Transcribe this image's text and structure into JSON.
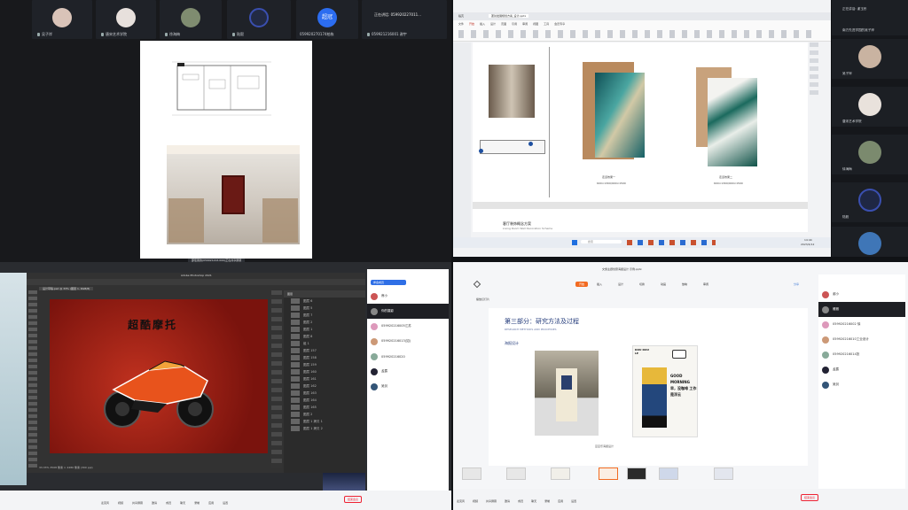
{
  "top_left": {
    "tiles": [
      {
        "name": "吴子岸"
      },
      {
        "name": "唐宋艺术学院"
      },
      {
        "name": "徐海梅"
      },
      {
        "name": "陆毅"
      },
      {
        "name": "059920270174柏栋",
        "initials": "超冠"
      },
      {
        "name": "059921216001 谢宇"
      }
    ],
    "speaking": "正在讲话: 059920227011...",
    "caption": "邵佳豪的(059921216 000)正在共享屏幕"
  },
  "top_right": {
    "window_title": "蓬勃发展规划方案_设计.pptx",
    "tabs": [
      "稻壳",
      "蓬勃发展规划方案_设计.pptx"
    ],
    "menu": [
      "文件",
      "开始",
      "插入",
      "设计",
      "页面",
      "引用",
      "审阅",
      "视图",
      "工具",
      "会员专享"
    ],
    "page_label": "页",
    "slide": {
      "caption1": "走道效果一",
      "dims1": "600×1300/900×1500",
      "caption2": "走道效果二",
      "dims2": "600×1300/900×1500",
      "section_title": "客厅装饰概念方案",
      "section_sub": "Living Room Wall Decoration Scheme"
    },
    "taskbar_search": "搜索",
    "clock": "14:44",
    "date": "2023/4/12"
  },
  "right_participants": [
    {
      "name": "正在讲话: 谢玉彤"
    },
    {
      "name": "南方先进学园的吴子岸"
    },
    {
      "name": "吴子岸"
    },
    {
      "name": "唐宋艺术学院"
    },
    {
      "name": "徐海梅"
    },
    {
      "name": "陆毅"
    },
    {
      "name": "陆毅"
    }
  ],
  "bottom_left": {
    "ps_title": "Adobe Photoshop 2021",
    "doc_tab": "设计草稿.psd @ 33% (图层 1, RGB/8)",
    "artwork_text": "超酷摩托",
    "status": "33.33%  3508 像素 × 2480 像素 (300 ppi)",
    "layers": [
      "图层 6",
      "图层 5",
      "图层 7",
      "图层 2",
      "图层 1",
      "图层 8",
      "组 1",
      "图层 157",
      "图层 158",
      "图层 159",
      "图层 160",
      "图层 161",
      "图层 162",
      "图层 163",
      "图层 164",
      "图层 165",
      "图层 2",
      "图层 1 拷贝 1",
      "图层 1 拷贝 2"
    ],
    "layer_panel_title": "图层",
    "panel_header": "参会成员",
    "members": [
      "睿小",
      "你的摄影",
      "059920216005江苏",
      "059920216013(如)",
      "059920216020",
      "孟露",
      "吴剑"
    ],
    "toolbar": [
      "麦克风",
      "视频",
      "共享屏幕",
      "邀请",
      "成员",
      "聊天",
      "录制",
      "应用",
      "设置"
    ],
    "end_label": "结束会议"
  },
  "bottom_right": {
    "file_title": "文旅主题创意海报设计 示例.pptx",
    "ribbon": [
      "开始",
      "插入",
      "设计",
      "切换",
      "动画",
      "放映",
      "审阅"
    ],
    "active_ribbon": "开始",
    "share": "分享",
    "play": "播放幻灯片",
    "slide_title": "第三部分：研究方法及过程",
    "slide_sub": "RESEARCH METHODS AND PROCESSES",
    "slide_heading": "海报设计",
    "poster_caption": "豆豆乐海报设计",
    "poster_text": "GOOD MORNING 早，没咖啡 工作是浮云",
    "poster_brand": "DOU DOU LE",
    "members": [
      "谢小",
      "雅雅",
      "059920216002 徐",
      "059920216010工业设计",
      "059920216014张",
      "孟露",
      "吴剑"
    ],
    "toolbar": [
      "麦克风",
      "视频",
      "共享屏幕",
      "邀请",
      "成员",
      "聊天",
      "录制",
      "应用",
      "设置"
    ],
    "end_label": "结束会议"
  }
}
